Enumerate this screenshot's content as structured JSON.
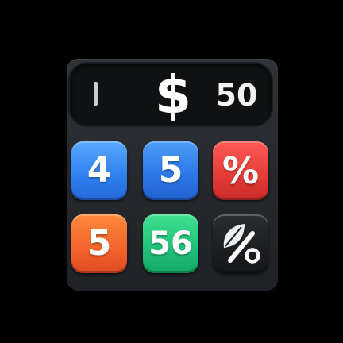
{
  "display": {
    "currency_symbol": "$",
    "amount": "50"
  },
  "keypad": {
    "keys": [
      {
        "label": "4",
        "color": "#2f7fef"
      },
      {
        "label": "5",
        "color": "#2b76e6"
      },
      {
        "label": "%",
        "color": "#e53a35"
      },
      {
        "label": "5",
        "color": "#f2632c"
      },
      {
        "label": "56",
        "color": "#1fc178"
      },
      {
        "label": "%",
        "color": "#1c1e21",
        "icon": "leaf-icon"
      }
    ]
  }
}
